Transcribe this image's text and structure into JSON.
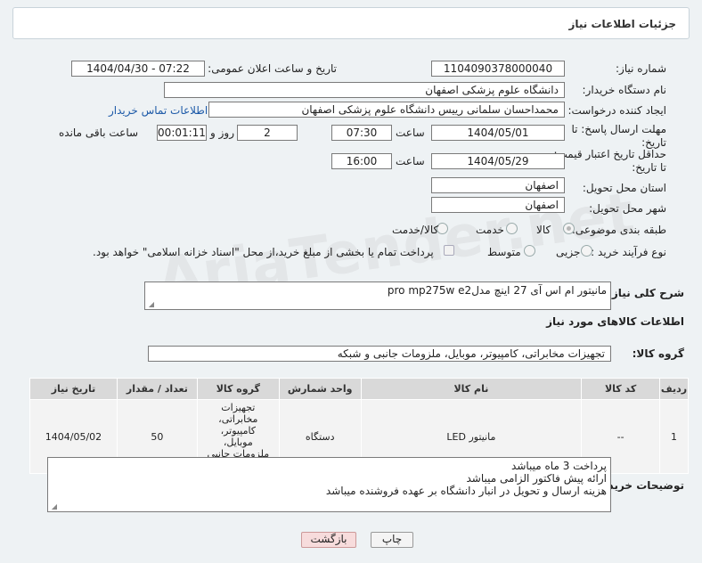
{
  "header": {
    "title": "جزئیات اطلاعات نیاز"
  },
  "watermark": "AriaTender.net",
  "fields": {
    "need_number_label": "شماره نیاز:",
    "need_number": "1104090378000040",
    "announce_label": "تاریخ و ساعت اعلان عمومی:",
    "announce_value": "1404/04/30 - 07:22",
    "buyer_org_label": "نام دستگاه خریدار:",
    "buyer_org": "دانشگاه علوم پزشکی اصفهان",
    "creator_label": "ایجاد کننده درخواست:",
    "creator": "محمداحسان سلمانی رییس دانشگاه علوم پزشکی اصفهان",
    "contact_link": "اطلاعات تماس خریدار",
    "deadline_label": "مهلت ارسال پاسخ: تا تاریخ:",
    "deadline_date": "1404/05/01",
    "time_word": "ساعت",
    "deadline_time": "07:30",
    "days_value": "2",
    "days_and": "روز و",
    "remaining_time": "00:01:11",
    "remaining_label": "ساعت باقی مانده",
    "price_validity_label": "حداقل تاریخ اعتبار قیمت: تا تاریخ:",
    "price_validity_date": "1404/05/29",
    "price_validity_time": "16:00",
    "province_label": "استان محل تحویل:",
    "province": "اصفهان",
    "city_label": "شهر محل تحویل:",
    "city": "اصفهان",
    "category_label": "طبقه بندی موضوعی:",
    "category_options": [
      "کالا",
      "خدمت",
      "کالا/خدمت"
    ],
    "category_selected": "کالا",
    "process_label": "نوع فرآیند خرید :",
    "process_options": [
      "جزیی",
      "متوسط"
    ],
    "payment_note": "پرداخت تمام یا بخشی از مبلغ خرید،از محل \"اسناد خزانه اسلامی\" خواهد بود."
  },
  "description": {
    "label": "شرح کلی نیاز:",
    "value": "مانیتور ام اس آی 27 اینچ مدلpro mp275w e2"
  },
  "items_section": {
    "title": "اطلاعات کالاهای مورد نیاز",
    "group_label": "گروه کالا:",
    "group_value": "تجهیزات مخابراتی، کامپیوتر، موبایل، ملزومات جانبی و شبکه"
  },
  "table": {
    "headers": [
      "ردیف",
      "کد کالا",
      "نام کالا",
      "واحد شمارش",
      "گروه کالا",
      "تعداد / مقدار",
      "تاریخ نیاز"
    ],
    "rows": [
      [
        "1",
        "--",
        "مانیتور LED",
        "دستگاه",
        "تجهیزات مخابراتی، کامپیوتر، موبایل، ملزومات جانبی و شبکه",
        "50",
        "1404/05/02"
      ]
    ]
  },
  "buyer_notes": {
    "label": "توضیحات خریدار:",
    "lines": [
      "پرداخت 3 ماه میباشد",
      "ارائه پیش فاکتور الزامی میباشد",
      "هزینه ارسال و تحویل در انبار دانشگاه بر عهده فروشنده میباشد"
    ]
  },
  "buttons": {
    "print": "چاپ",
    "back": "بازگشت"
  }
}
